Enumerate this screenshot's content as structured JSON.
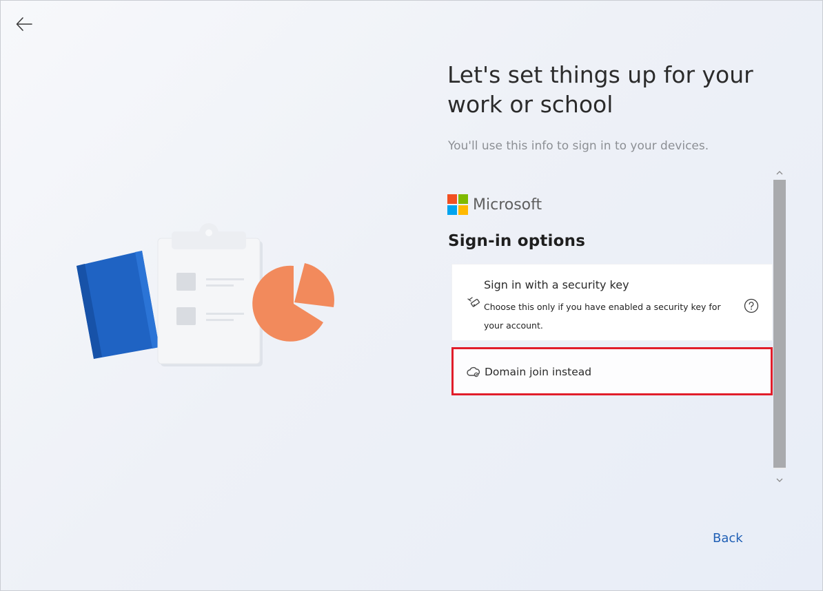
{
  "header": {
    "back_arrow_icon": "arrow-left-icon"
  },
  "main": {
    "title": "Let's set things up for your work or school",
    "subtitle": "You'll use this info to sign in to your devices."
  },
  "brand": {
    "name": "Microsoft",
    "logo_colors": [
      "#f25022",
      "#7fba00",
      "#00a4ef",
      "#ffb900"
    ]
  },
  "signin": {
    "section_title": "Sign-in options",
    "options": [
      {
        "title": "Sign in with a security key",
        "description": "Choose this only if you have enabled a security key for your account.",
        "icon": "security-key-icon",
        "help_icon": "help-icon"
      },
      {
        "title": "Domain join instead",
        "icon": "cloud-icon",
        "highlighted": true,
        "highlight_color": "#e11d2a"
      }
    ]
  },
  "footer": {
    "back_label": "Back",
    "link_color": "#1f5fb5"
  },
  "illustration": {
    "items": [
      "notebook",
      "clipboard",
      "pie-chart"
    ]
  }
}
